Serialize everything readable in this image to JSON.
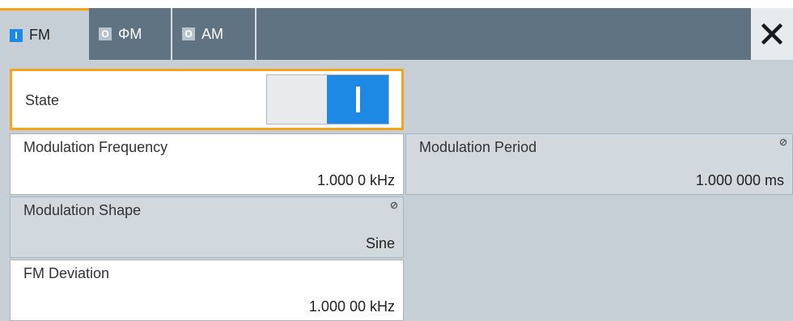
{
  "tabs": [
    {
      "label": "FM",
      "indicator": "I",
      "active": true
    },
    {
      "label": "ΦM",
      "indicator": "O",
      "active": false
    },
    {
      "label": "AM",
      "indicator": "O",
      "active": false
    }
  ],
  "close_icon": "close-icon",
  "state": {
    "label": "State",
    "value": "on"
  },
  "modulation_frequency": {
    "label": "Modulation Frequency",
    "value": "1.000 0 kHz"
  },
  "modulation_period": {
    "label": "Modulation Period",
    "value": "1.000 000 ms",
    "locked": true
  },
  "modulation_shape": {
    "label": "Modulation Shape",
    "value": "Sine",
    "locked": true
  },
  "fm_deviation": {
    "label": "FM Deviation",
    "value": "1.000 00 kHz"
  },
  "colors": {
    "accent": "#f5a31a",
    "blue": "#1e88e5",
    "tabbar": "#5f7382",
    "panel": "#c6cfd6"
  }
}
